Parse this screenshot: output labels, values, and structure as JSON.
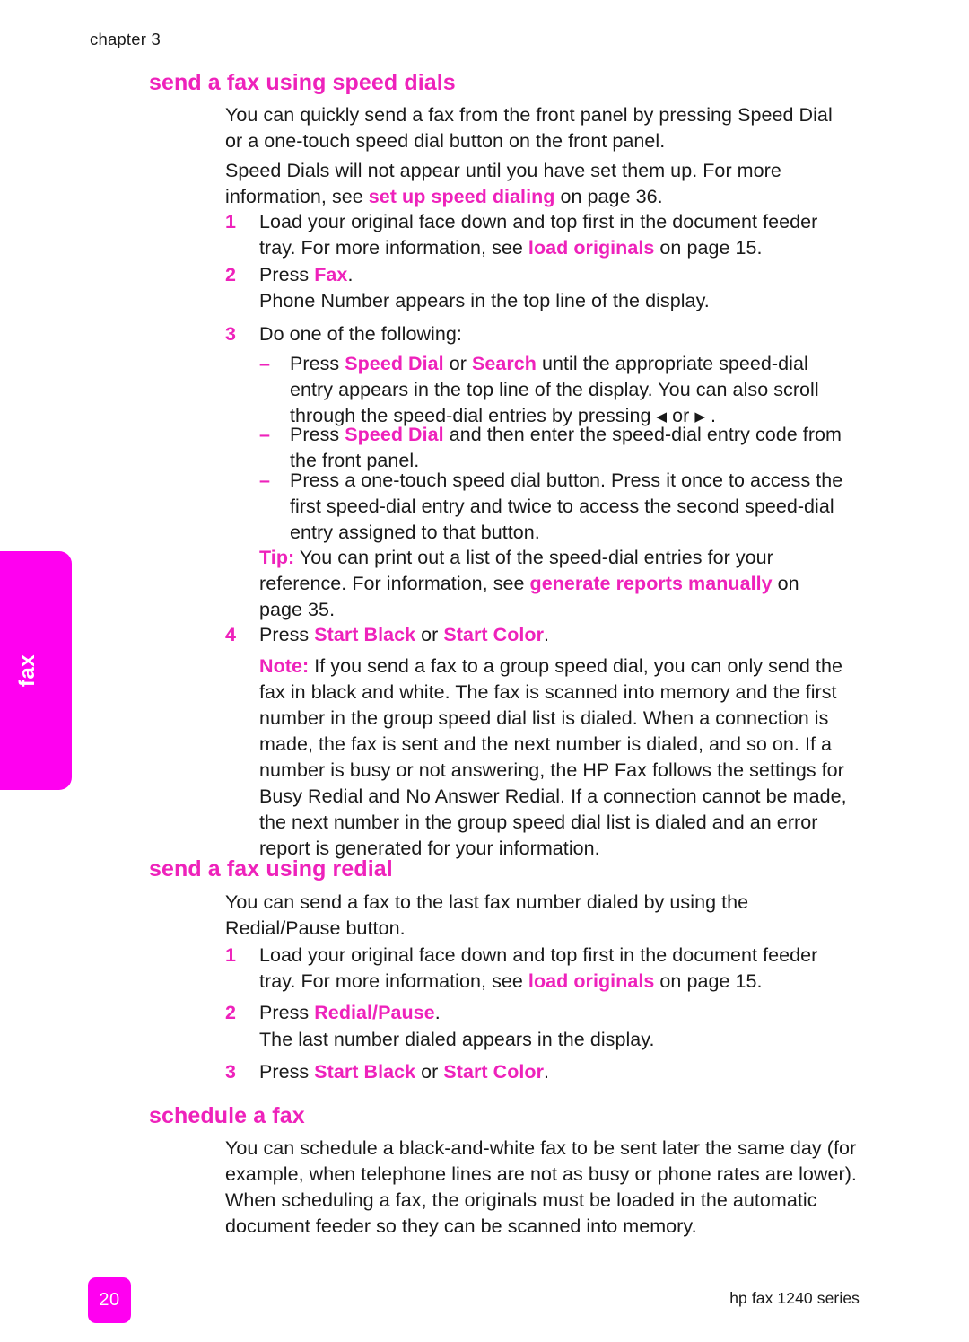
{
  "running_head": "chapter 3",
  "side_tab": {
    "label": "fax"
  },
  "colors": {
    "accent_magenta": "#ee22bb",
    "tab_magenta": "#ff00f0",
    "body_text": "#1a1a1a"
  },
  "sections": {
    "speed_dials": {
      "title": "send a fax using speed dials",
      "intro_1": "You can quickly send a fax from the front panel by pressing Speed Dial or a one-touch speed dial button on the front panel.",
      "intro_2_a": "Speed Dials will not appear until you have set them up. For more information, see ",
      "intro_2_link": "set up speed dialing",
      "intro_2_b": " on page 36.",
      "step1_num": "1",
      "step1_a": "Load your original face down and top first in the document feeder tray. For more information, see ",
      "step1_link": "load originals",
      "step1_b": " on page 15.",
      "step2_num": "2",
      "step2_a": "Press ",
      "step2_bold": "Fax",
      "step2_b": ".",
      "step2_note": "Phone Number appears in the top line of the display.",
      "step3_num": "3",
      "step3_lead": "Do one of the following:",
      "bullet_mark": "–",
      "b1_a": "Press ",
      "b1_bold1": "Speed Dial",
      "b1_b": " or ",
      "b1_bold2": "Search",
      "b1_c": " until the appropriate speed-dial entry appears in the top line of the display. You can also scroll through the speed-dial entries by pressing ",
      "b1_arrow_left": "◀",
      "b1_d": " or ",
      "b1_arrow_right": "▶",
      "b1_e": " .",
      "b2_a": "Press ",
      "b2_bold": "Speed Dial",
      "b2_b": " and then enter the speed-dial entry code from the front panel.",
      "b3": "Press a one-touch speed dial button. Press it once to access the first speed-dial entry and twice to access the second speed-dial entry assigned to that button.",
      "tip_label": "Tip:",
      "tip_a": "  You can print out a list of the speed-dial entries for your reference. For information, see ",
      "tip_link": "generate reports manually",
      "tip_b": " on page 35.",
      "step4_num": "4",
      "step4_a": "Press ",
      "step4_bold1": "Start Black",
      "step4_b": " or ",
      "step4_bold2": "Start Color",
      "step4_c": ".",
      "note_label": "Note:",
      "note_text": "  If you send a fax to a group speed dial, you can only send the fax in black and white. The fax is scanned into memory and the first number in the group speed dial list is dialed. When a connection is made, the fax is sent and the next number is dialed, and so on. If a number is busy or not answering, the HP Fax follows the settings for Busy Redial and No Answer Redial. If a connection cannot be made, the next number in the group speed dial list is dialed and an error report is generated for your information."
    },
    "redial": {
      "title": "send a fax using redial",
      "intro": "You can send a fax to the last fax number dialed by using the Redial/Pause button.",
      "step1_num": "1",
      "step1_a": "Load your original face down and top first in the document feeder tray. For more information, see ",
      "step1_link": "load originals",
      "step1_b": " on page 15.",
      "step2_num": "2",
      "step2_a": "Press ",
      "step2_bold": "Redial/Pause",
      "step2_b": ".",
      "step2_note": "The last number dialed appears in the display.",
      "step3_num": "3",
      "step3_a": "Press ",
      "step3_bold1": "Start Black",
      "step3_b": " or ",
      "step3_bold2": "Start Color",
      "step3_c": "."
    },
    "schedule": {
      "title": "schedule a fax",
      "intro": "You can schedule a black-and-white fax to be sent later the same day (for example, when telephone lines are not as busy or phone rates are lower). When scheduling a fax, the originals must be loaded in the automatic document feeder so they can be scanned into memory."
    }
  },
  "footer": {
    "page_number": "20",
    "product": "hp fax 1240 series"
  }
}
